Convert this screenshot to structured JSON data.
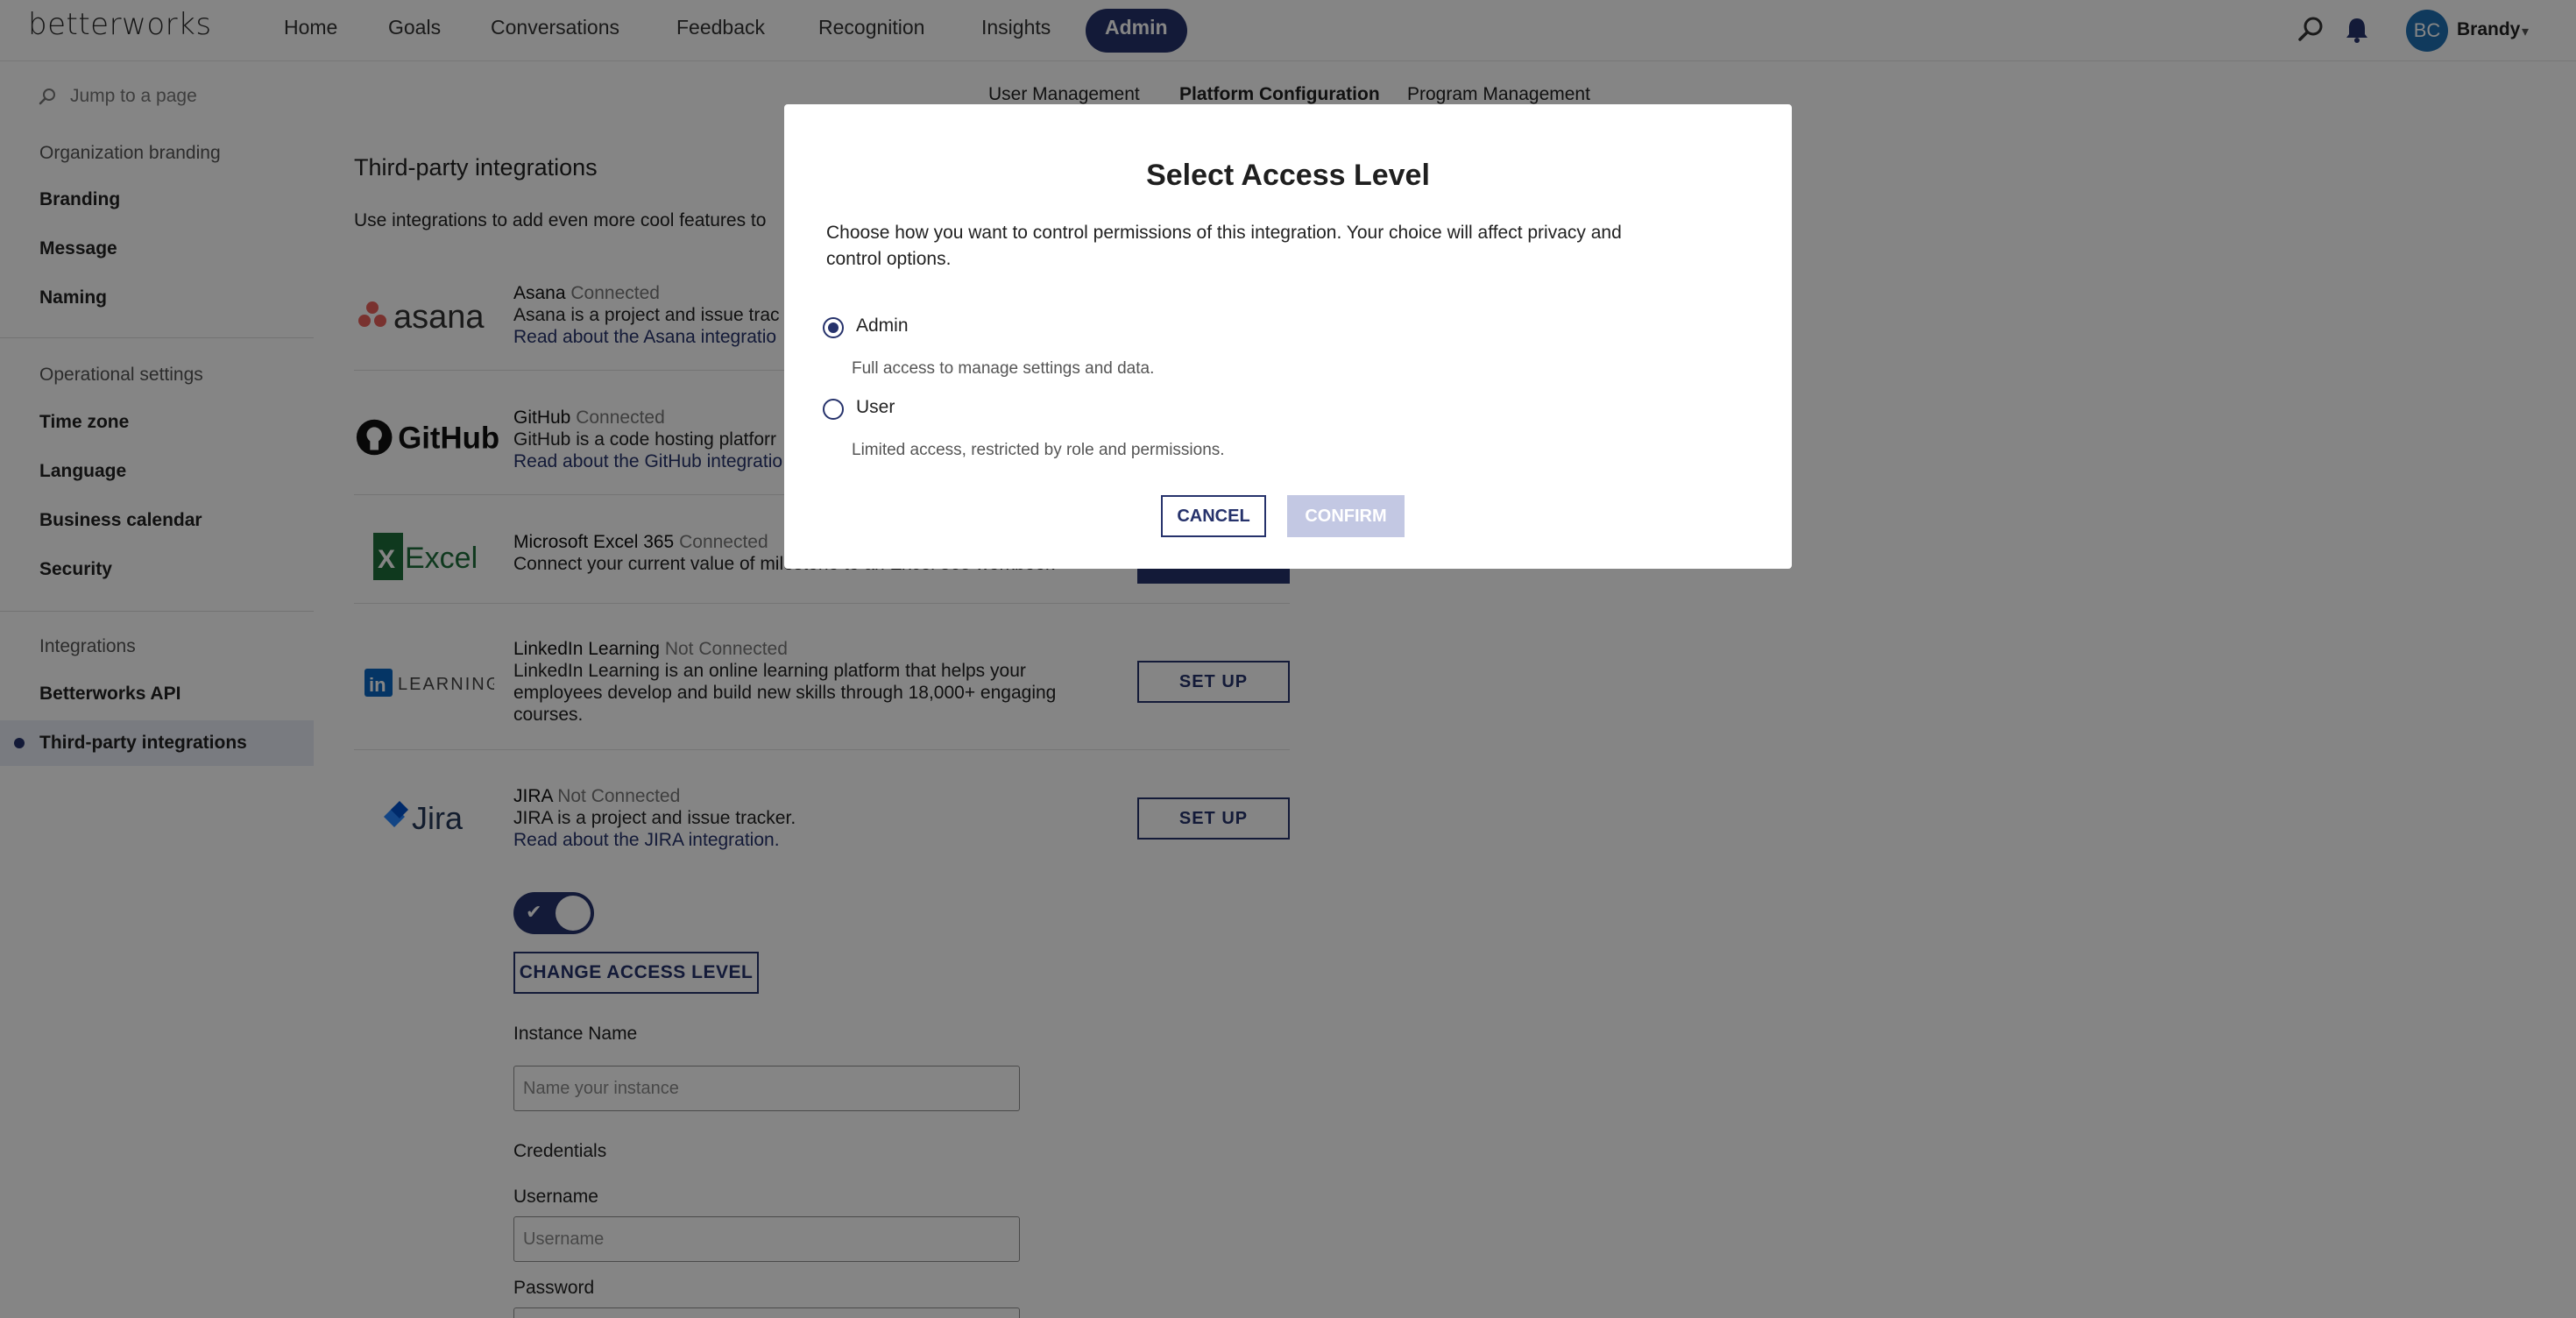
{
  "app": {
    "logo": "betterworks"
  },
  "nav": {
    "items": [
      "Home",
      "Goals",
      "Conversations",
      "Feedback",
      "Recognition",
      "Insights"
    ],
    "active": "Admin"
  },
  "user": {
    "initials": "BC",
    "name": "Brandy"
  },
  "subtabs": [
    "User Management",
    "Platform Configuration",
    "Program Management"
  ],
  "sidebar": {
    "jump_placeholder": "Jump to a page",
    "sections": [
      {
        "title": "Organization branding",
        "items": [
          "Branding",
          "Message",
          "Naming"
        ]
      },
      {
        "title": "Operational settings",
        "items": [
          "Time zone",
          "Language",
          "Business calendar",
          "Security"
        ]
      },
      {
        "title": "Integrations",
        "items": [
          "Betterworks API",
          "Third-party integrations"
        ]
      }
    ],
    "active_item": "Third-party integrations"
  },
  "main": {
    "title": "Third-party integrations",
    "description": "Use integrations to add even more cool features to",
    "integrations": [
      {
        "logo": "asana",
        "name": "Asana",
        "status": "Connected",
        "desc": "Asana is a project and issue trac",
        "link": "Read about the Asana integratio"
      },
      {
        "logo": "GitHub",
        "name": "GitHub",
        "status": "Connected",
        "desc": "GitHub is a code hosting platforr",
        "link": "Read about the GitHub integratio"
      },
      {
        "logo": "Excel",
        "name": "Microsoft Excel 365",
        "status": "Connected",
        "desc": "Connect your current value of milestone to an Excel 365 workbook",
        "link": ""
      },
      {
        "logo": "LEARNING",
        "name": "LinkedIn Learning",
        "status": "Not Connected",
        "desc": "LinkedIn Learning is an online learning platform that helps your employees develop and build new skills through 18,000+ engaging courses.",
        "link": "",
        "button": "SET UP"
      },
      {
        "logo": "Jira",
        "name": "JIRA",
        "status": "Not Connected",
        "desc": "JIRA is a project and issue tracker.",
        "link": "Read about the JIRA integration.",
        "button": "SET UP"
      }
    ],
    "change_access_label": "CHANGE ACCESS LEVEL",
    "instance_name_label": "Instance Name",
    "instance_name_placeholder": "Name your instance",
    "credentials_label": "Credentials",
    "username_label": "Username",
    "username_placeholder": "Username",
    "password_label": "Password"
  },
  "modal": {
    "title": "Select Access Level",
    "description": "Choose how you want to control permissions of this integration. Your choice will affect privacy and control options.",
    "options": [
      {
        "label": "Admin",
        "desc": "Full access to manage settings and data.",
        "selected": true
      },
      {
        "label": "User",
        "desc": "Limited access, restricted by role and permissions.",
        "selected": false
      }
    ],
    "cancel_label": "CANCEL",
    "confirm_label": "CONFIRM"
  },
  "colors": {
    "brand": "#26326b",
    "confirm_disabled": "#c3c8e3",
    "avatar": "#1f6fb2"
  }
}
